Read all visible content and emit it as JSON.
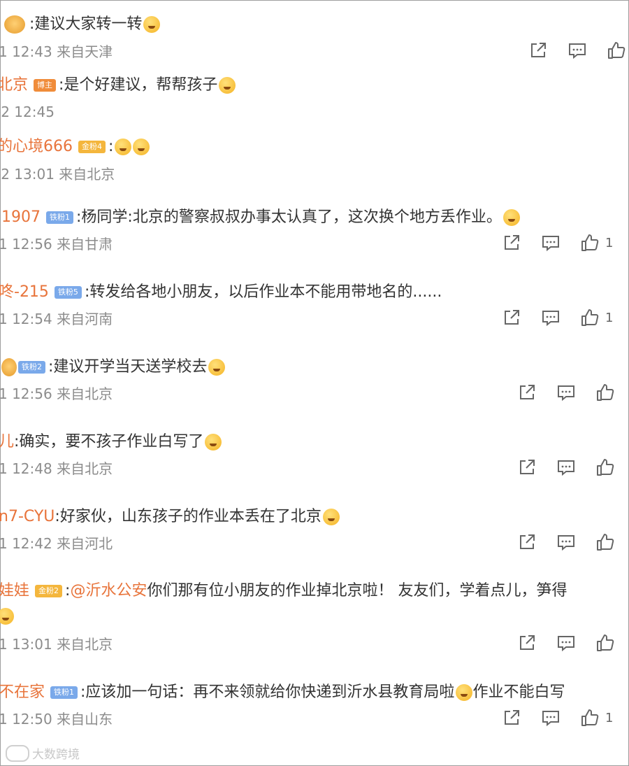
{
  "comments": [
    {
      "user": "",
      "badge": "",
      "text": ":建议大家转一转",
      "mention": "",
      "tail": "",
      "meta": "1 12:43 来自天津",
      "likes": ""
    },
    {
      "user": "北京",
      "badge": "博主",
      "text": ":是个好建议，帮帮孩子",
      "mention": "",
      "tail": "",
      "meta": "-2 12:45",
      "likes": ""
    },
    {
      "user": "的心境666",
      "badge": "金粉4",
      "text": ":",
      "mention": "",
      "tail": "",
      "meta": "-2 13:01 来自北京",
      "likes": ""
    },
    {
      "user": "1907",
      "badge": "铁粉1",
      "text": ":杨同学:北京的警察叔叔办事太认真了，这次换个地方丢作业。",
      "mention": "",
      "tail": "",
      "meta": "1 12:56 来自甘肃",
      "likes": "1"
    },
    {
      "user": "咚-215",
      "badge": "铁粉5",
      "text": ":转发给各地小朋友，以后作业本不能用带地名的......",
      "mention": "",
      "tail": "",
      "meta": "1 12:54 来自河南",
      "likes": "1"
    },
    {
      "user": "",
      "badge": "铁粉2",
      "text": ":建议开学当天送学校去",
      "mention": "",
      "tail": "",
      "meta": "1 12:56 来自北京",
      "likes": ""
    },
    {
      "user": "儿",
      "badge": "",
      "text": ":确实，要不孩子作业白写了",
      "mention": "",
      "tail": "",
      "meta": "1 12:48 来自北京",
      "likes": ""
    },
    {
      "user": "n7-CYU",
      "badge": "",
      "text": ":好家伙，山东孩子的作业本丢在了北京",
      "mention": "",
      "tail": "",
      "meta": "1 12:42 来自河北",
      "likes": ""
    },
    {
      "user": "娃娃",
      "badge": "金粉2",
      "text": ":",
      "mention": "@沂水公安",
      "tail": " 你们那有位小朋友的作业掉北京啦！ 友友们，学着点儿，笋得",
      "meta": "1 13:01 来自北京",
      "likes": ""
    },
    {
      "user": "不在家",
      "badge": "铁粉1",
      "text": ":应该加一句话：再不来领就给你快递到沂水县教育局啦",
      "mention": "",
      "tail": "作业不能白写",
      "meta": "1 12:50 来自山东",
      "likes": "1"
    }
  ],
  "icons": {
    "share": "share-icon",
    "comment": "comment-icon",
    "like": "thumbs-up-icon"
  },
  "colors": {
    "username": "#e8743b",
    "meta": "#8c8c8c",
    "gold_badge": "#f4b63d",
    "iron_badge": "#7aa9ea",
    "host_badge": "#f08c3a"
  },
  "watermark": "大数跨境"
}
